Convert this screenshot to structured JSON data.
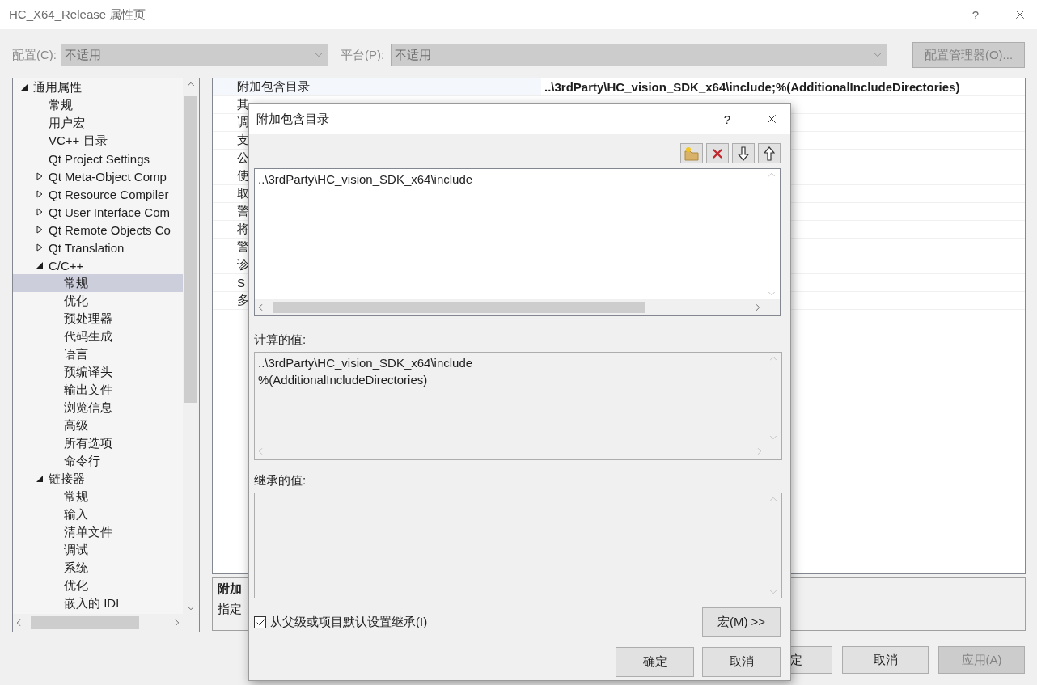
{
  "window": {
    "title": "HC_X64_Release 属性页",
    "help": "?"
  },
  "config_bar": {
    "config_label": "配置(C):",
    "config_value": "不适用",
    "platform_label": "平台(P):",
    "platform_value": "不适用",
    "manager_button": "配置管理器(O)...",
    "disabled": true
  },
  "tree": {
    "items": [
      {
        "label": "通用属性",
        "kind": "group",
        "expanded": true,
        "selected": false,
        "children": [
          {
            "label": "常规",
            "kind": "page",
            "selected": false
          },
          {
            "label": "用户宏",
            "kind": "page",
            "selected": false
          },
          {
            "label": "VC++ 目录",
            "kind": "page",
            "selected": false
          },
          {
            "label": "Qt Project Settings",
            "kind": "page",
            "selected": false
          },
          {
            "label": "Qt Meta-Object Comp",
            "kind": "group",
            "expanded": false,
            "selected": false
          },
          {
            "label": "Qt Resource Compiler",
            "kind": "group",
            "expanded": false,
            "selected": false
          },
          {
            "label": "Qt User Interface Com",
            "kind": "group",
            "expanded": false,
            "selected": false
          },
          {
            "label": "Qt Remote Objects Co",
            "kind": "group",
            "expanded": false,
            "selected": false
          },
          {
            "label": "Qt Translation",
            "kind": "group",
            "expanded": false,
            "selected": false
          },
          {
            "label": "C/C++",
            "kind": "group",
            "expanded": true,
            "selected": false,
            "children": [
              {
                "label": "常规",
                "kind": "page",
                "selected": true
              },
              {
                "label": "优化",
                "kind": "page",
                "selected": false
              },
              {
                "label": "预处理器",
                "kind": "page",
                "selected": false
              },
              {
                "label": "代码生成",
                "kind": "page",
                "selected": false
              },
              {
                "label": "语言",
                "kind": "page",
                "selected": false
              },
              {
                "label": "预编译头",
                "kind": "page",
                "selected": false
              },
              {
                "label": "输出文件",
                "kind": "page",
                "selected": false
              },
              {
                "label": "浏览信息",
                "kind": "page",
                "selected": false
              },
              {
                "label": "高级",
                "kind": "page",
                "selected": false
              },
              {
                "label": "所有选项",
                "kind": "page",
                "selected": false
              },
              {
                "label": "命令行",
                "kind": "page",
                "selected": false
              }
            ]
          },
          {
            "label": "链接器",
            "kind": "group",
            "expanded": true,
            "selected": false,
            "children": [
              {
                "label": "常规",
                "kind": "page",
                "selected": false
              },
              {
                "label": "输入",
                "kind": "page",
                "selected": false
              },
              {
                "label": "清单文件",
                "kind": "page",
                "selected": false
              },
              {
                "label": "调试",
                "kind": "page",
                "selected": false
              },
              {
                "label": "系统",
                "kind": "page",
                "selected": false
              },
              {
                "label": "优化",
                "kind": "page",
                "selected": false
              },
              {
                "label": "嵌入的 IDL",
                "kind": "page",
                "selected": false
              }
            ]
          }
        ]
      }
    ]
  },
  "property_grid": {
    "rows": [
      {
        "name": "附加包含目录",
        "value": "..\\3rdParty\\HC_vision_SDK_x64\\include;%(AdditionalIncludeDirectories)"
      },
      {
        "name": "其"
      },
      {
        "name": "调"
      },
      {
        "name": "支"
      },
      {
        "name": "公"
      },
      {
        "name": "使"
      },
      {
        "name": "取"
      },
      {
        "name": "警"
      },
      {
        "name": "将"
      },
      {
        "name": "警"
      },
      {
        "name": "诊"
      },
      {
        "name": "S"
      },
      {
        "name": "多"
      }
    ]
  },
  "description": {
    "title": "附加",
    "text": "指定"
  },
  "buttons": [
    {
      "label": "定",
      "disabled": false
    },
    {
      "label": "取消",
      "disabled": false
    },
    {
      "label": "应用(A)",
      "disabled": true
    }
  ],
  "dialog": {
    "title": "附加包含目录",
    "help": "?",
    "entries": [
      "..\\3rdParty\\HC_vision_SDK_x64\\include"
    ],
    "computed_label": "计算的值:",
    "computed_lines": [
      "..\\3rdParty\\HC_vision_SDK_x64\\include",
      "%(AdditionalIncludeDirectories)"
    ],
    "inherited_label": "继承的值:",
    "inherit_checkbox": {
      "label": "从父级或项目默认设置继承(I)",
      "checked": true
    },
    "macro_button": "宏(M) >>",
    "buttons": [
      "确定",
      "取消"
    ]
  }
}
